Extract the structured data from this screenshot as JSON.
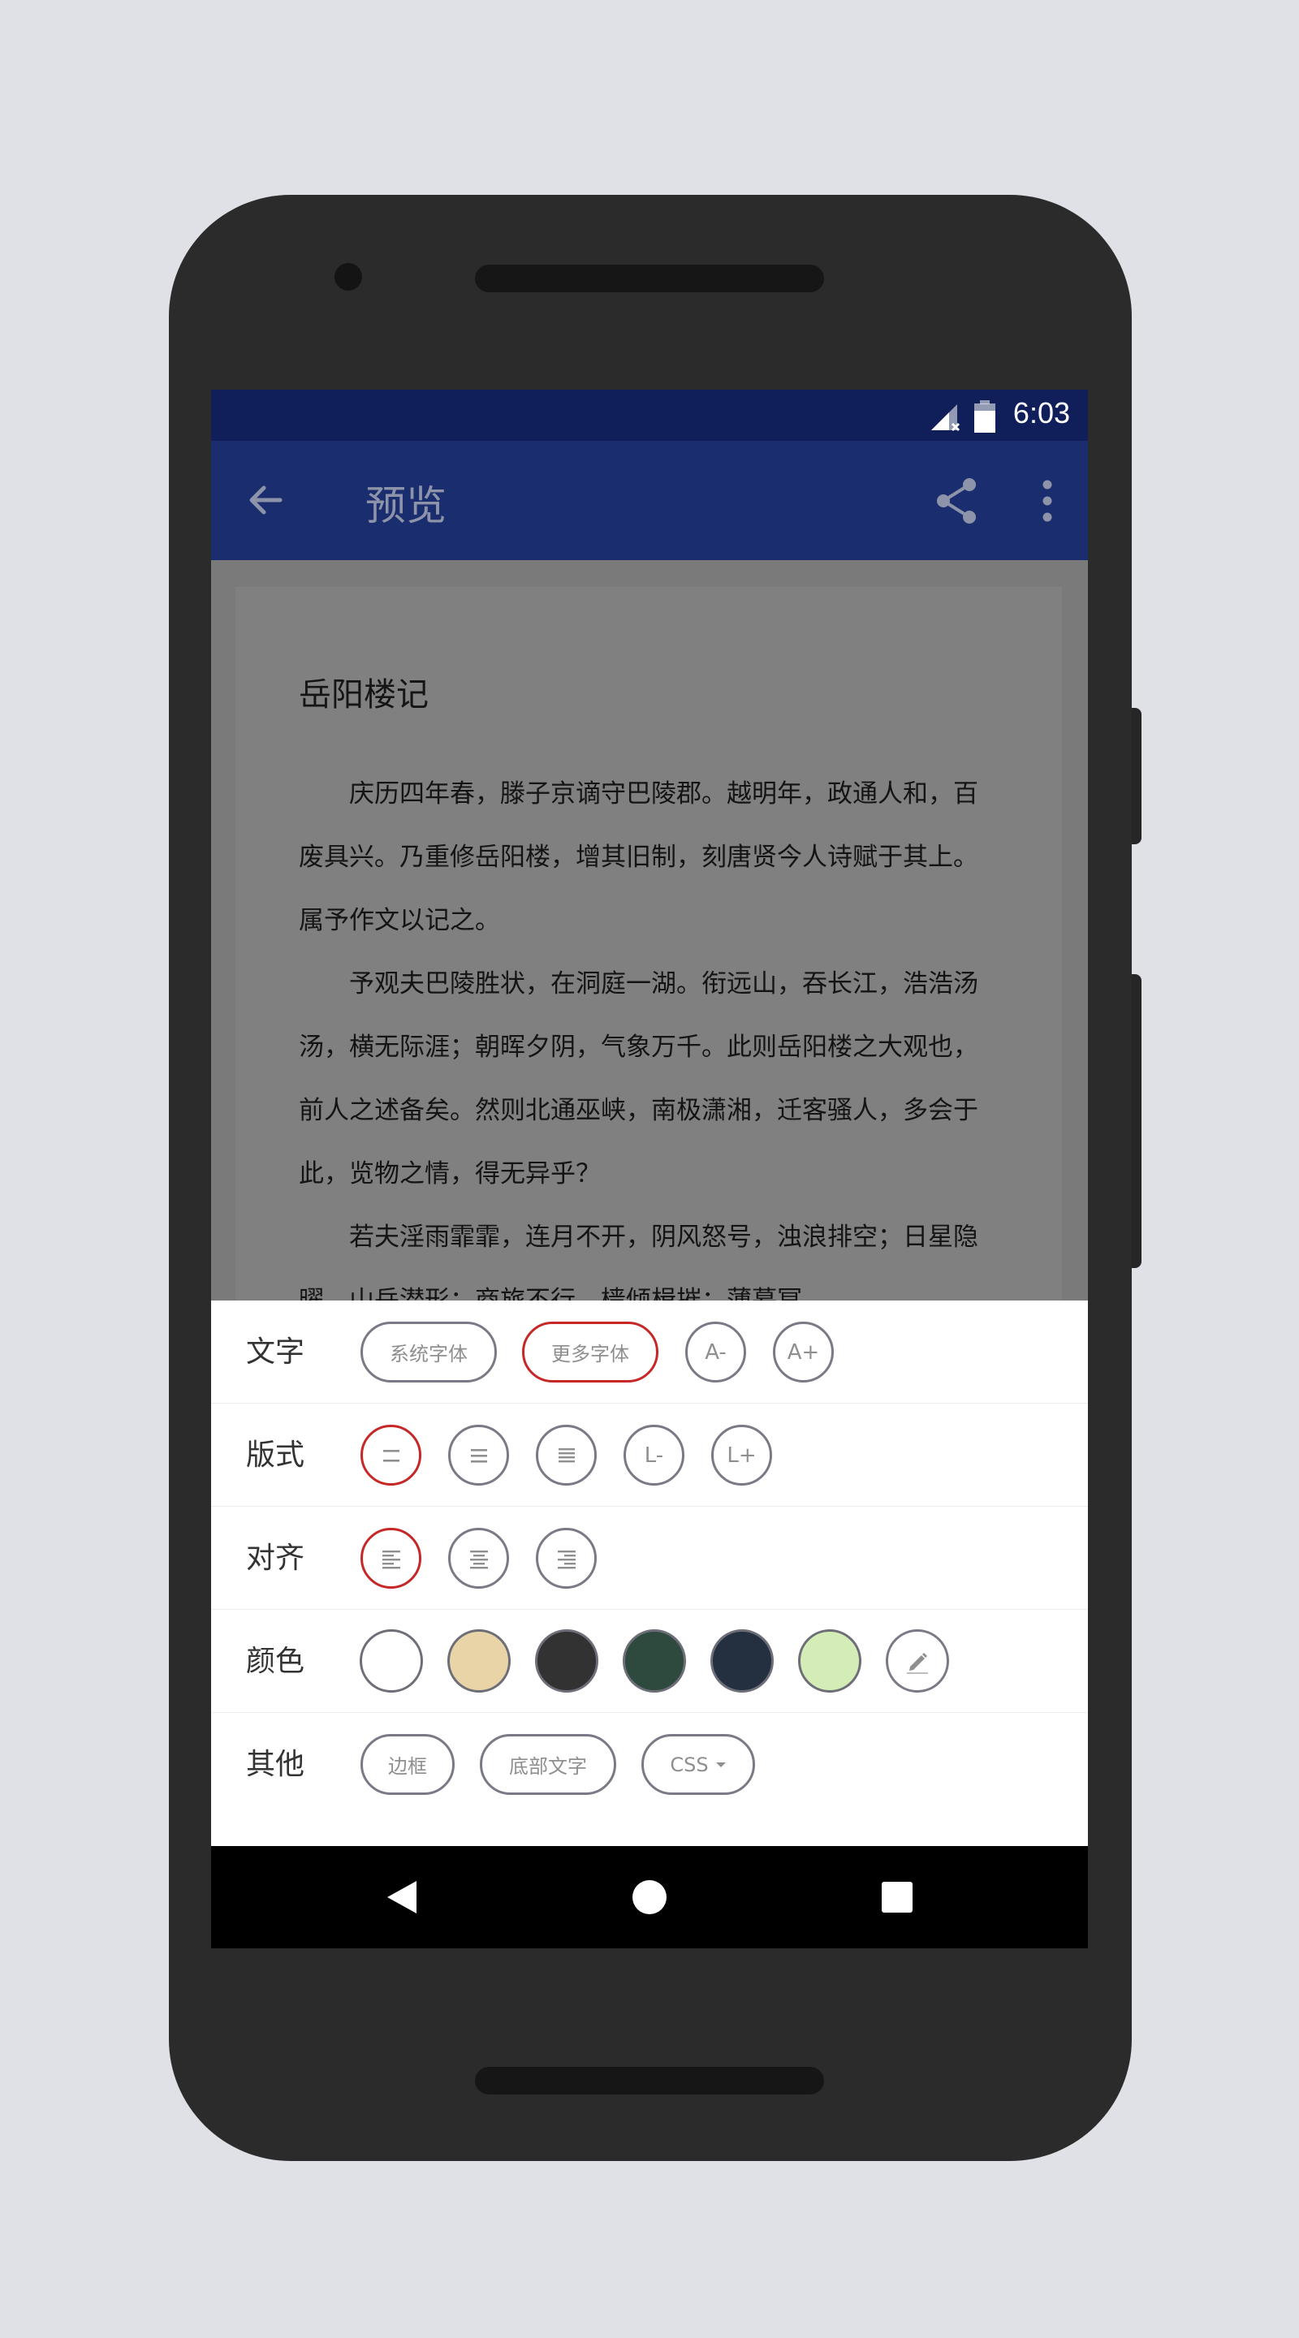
{
  "status_bar": {
    "time": "6:03",
    "icons": [
      "signal-no-sim-icon",
      "battery-icon"
    ]
  },
  "app_bar": {
    "title": "预览",
    "icons": [
      "back-arrow-icon",
      "share-icon",
      "more-vert-icon"
    ]
  },
  "document": {
    "title": "岳阳楼记",
    "paragraphs": [
      "庆历四年春，滕子京谪守巴陵郡。越明年，政通人和，百废具兴。乃重修岳阳楼，增其旧制，刻唐贤今人诗赋于其上。属予作文以记之。",
      "予观夫巴陵胜状，在洞庭一湖。衔远山，吞长江，浩浩汤汤，横无际涯；朝晖夕阴，气象万千。此则岳阳楼之大观也，前人之述备矣。然则北通巫峡，南极潇湘，迁客骚人，多会于此，览物之情，得无异乎？",
      "若夫淫雨霏霏，连月不开，阴风怒号，浊浪排空；日星隐曜，山岳潜形；商旅不行，樯倾楫摧；薄暮冥"
    ]
  },
  "settings": {
    "text": {
      "label": "文字",
      "system_font": "系统字体",
      "more_fonts": "更多字体",
      "font_smaller": "A-",
      "font_larger": "A+"
    },
    "layout": {
      "label": "版式",
      "line_smaller": "L-",
      "line_larger": "L+"
    },
    "align": {
      "label": "对齐"
    },
    "color": {
      "label": "颜色",
      "swatches": [
        "#ffffff",
        "#e8d4a6",
        "#323232",
        "#2e4a3e",
        "#243040",
        "#d4ecb6"
      ]
    },
    "other": {
      "label": "其他",
      "border": "边框",
      "footer_text": "底部文字",
      "css": "CSS"
    }
  },
  "colors": {
    "accent_selected": "#c62828",
    "app_bar": "#1a2d6e",
    "status_bar": "#101f5a"
  },
  "nav_bar": {
    "icons": [
      "back-icon",
      "home-icon",
      "recents-icon"
    ]
  }
}
